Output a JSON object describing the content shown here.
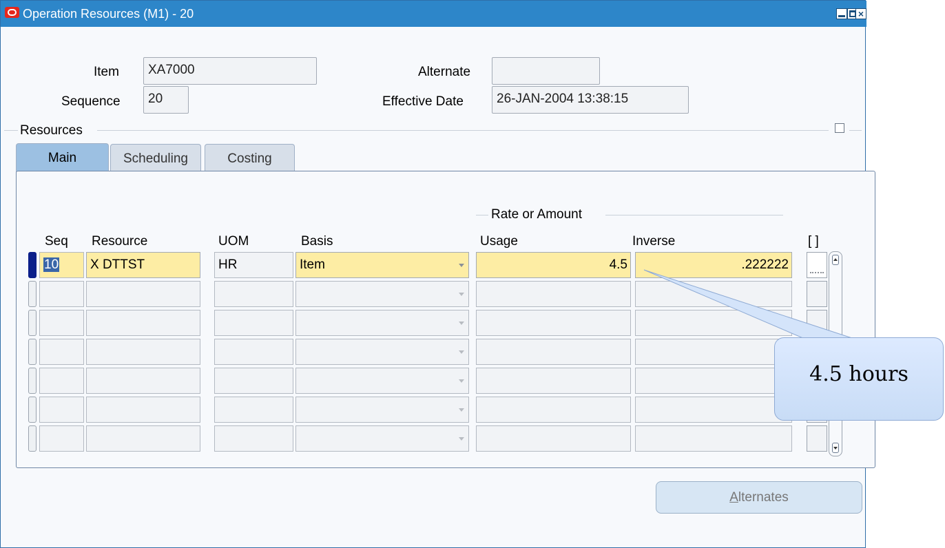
{
  "window": {
    "title": "Operation Resources (M1) - 20",
    "controls": [
      "minimize-icon",
      "maximize-icon",
      "close-icon"
    ]
  },
  "header": {
    "item_label": "Item",
    "item_value": "XA7000",
    "sequence_label": "Sequence",
    "sequence_value": "20",
    "alternate_label": "Alternate",
    "alternate_value": "",
    "effective_date_label": "Effective Date",
    "effective_date_value": "26-JAN-2004 13:38:15"
  },
  "resources": {
    "section_title": "Resources",
    "tabs": [
      {
        "label": "Main",
        "active": true
      },
      {
        "label": "Scheduling",
        "active": false
      },
      {
        "label": "Costing",
        "active": false
      }
    ],
    "group_title": "Rate or Amount",
    "columns": {
      "seq": "Seq",
      "resource": "Resource",
      "uom": "UOM",
      "basis": "Basis",
      "usage": "Usage",
      "inverse": "Inverse",
      "dff": "[ ]"
    },
    "rows": [
      {
        "seq": "10",
        "resource": "X DTTST",
        "uom": "HR",
        "basis": "Item",
        "usage": "4.5",
        "inverse": ".222222"
      },
      {
        "seq": "",
        "resource": "",
        "uom": "",
        "basis": "",
        "usage": "",
        "inverse": ""
      },
      {
        "seq": "",
        "resource": "",
        "uom": "",
        "basis": "",
        "usage": "",
        "inverse": ""
      },
      {
        "seq": "",
        "resource": "",
        "uom": "",
        "basis": "",
        "usage": "",
        "inverse": ""
      },
      {
        "seq": "",
        "resource": "",
        "uom": "",
        "basis": "",
        "usage": "",
        "inverse": ""
      },
      {
        "seq": "",
        "resource": "",
        "uom": "",
        "basis": "",
        "usage": "",
        "inverse": ""
      },
      {
        "seq": "",
        "resource": "",
        "uom": "",
        "basis": "",
        "usage": "",
        "inverse": ""
      }
    ]
  },
  "buttons": {
    "alternates_mnemonic": "A",
    "alternates_rest": "lternates"
  },
  "callout": {
    "text": "4.5 hours"
  },
  "colors": {
    "titlebar": "#2d86c9",
    "active_tab": "#9cc0e2",
    "required_field": "#fdeda4",
    "current_record": "#0b1f8a"
  }
}
